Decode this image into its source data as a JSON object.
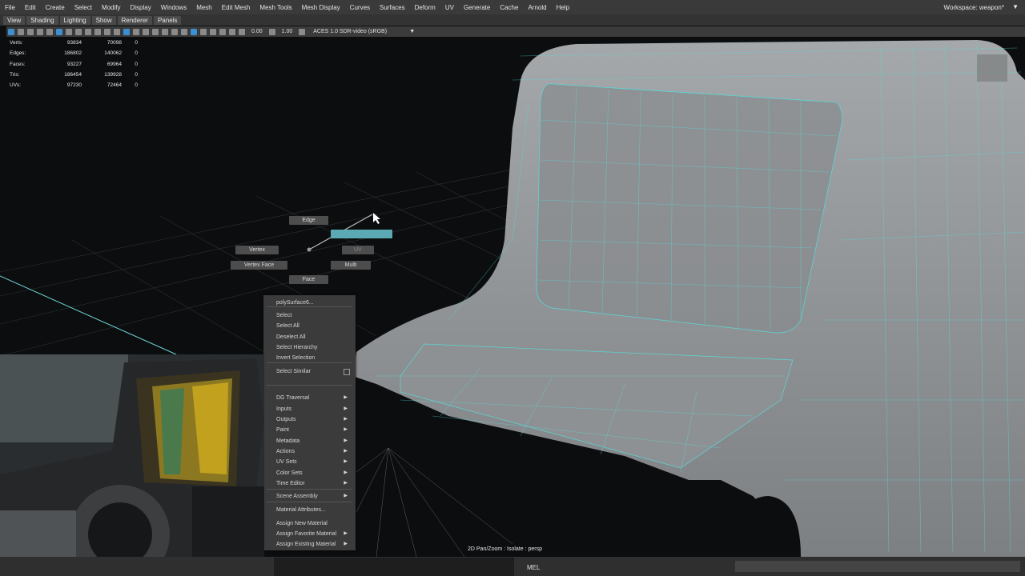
{
  "menubar": {
    "items": [
      "File",
      "Edit",
      "Create",
      "Select",
      "Modify",
      "Display",
      "Windows",
      "Mesh",
      "Edit Mesh",
      "Mesh Tools",
      "Mesh Display",
      "Curves",
      "Surfaces",
      "Deform",
      "UV",
      "Generate",
      "Cache",
      "Arnold",
      "Help"
    ],
    "workspace_label": "Workspace:",
    "workspace_value": "weapon*"
  },
  "panel_menu": [
    "View",
    "Shading",
    "Lighting",
    "Show",
    "Renderer",
    "Panels"
  ],
  "panel_toolbar": {
    "exposure": "0.00",
    "gamma": "1.00",
    "colorspace": "ACES 1.0 SDR-video (sRGB)"
  },
  "hud": {
    "rows": [
      {
        "label": "Verts:",
        "a": "93834",
        "b": "70098",
        "c": "0"
      },
      {
        "label": "Edges:",
        "a": "186802",
        "b": "140062",
        "c": "0"
      },
      {
        "label": "Faces:",
        "a": "93227",
        "b": "69964",
        "c": "0"
      },
      {
        "label": "Tris:",
        "a": "186454",
        "b": "139928",
        "c": "0"
      },
      {
        "label": "UVs:",
        "a": "97230",
        "b": "72464",
        "c": "0"
      }
    ]
  },
  "marking_menu": {
    "edge": "Edge",
    "vertex": "Vertex",
    "vertex_face": "Vertex Face",
    "face": "Face",
    "multi": "Multi",
    "uv": "UV"
  },
  "context_menu": {
    "items": [
      {
        "label": "polySurface6...",
        "arrow": false
      },
      {
        "label": "Select",
        "arrow": false
      },
      {
        "label": "Select All",
        "arrow": false
      },
      {
        "label": "Deselect All",
        "arrow": false
      },
      {
        "label": "Select Hierarchy",
        "arrow": false
      },
      {
        "label": "Invert Selection",
        "arrow": false
      },
      {
        "label": "Select Similar",
        "arrow": false,
        "option": true
      },
      {
        "label": "DG Traversal",
        "arrow": true
      },
      {
        "label": "Inputs",
        "arrow": true
      },
      {
        "label": "Outputs",
        "arrow": true
      },
      {
        "label": "Paint",
        "arrow": true
      },
      {
        "label": "Metadata",
        "arrow": true
      },
      {
        "label": "Actions",
        "arrow": true
      },
      {
        "label": "UV Sets",
        "arrow": true
      },
      {
        "label": "Color Sets",
        "arrow": true
      },
      {
        "label": "Time Editor",
        "arrow": true
      },
      {
        "label": "Scene Assembly",
        "arrow": true
      },
      {
        "label": "Material Attributes...",
        "arrow": false
      },
      {
        "label": "Assign New Material",
        "arrow": false
      },
      {
        "label": "Assign Favorite Material",
        "arrow": true
      },
      {
        "label": "Assign Existing Material",
        "arrow": true
      }
    ]
  },
  "viewport": {
    "panel_label": "2D Pan/Zoom : Isolate : persp"
  },
  "command_line": {
    "label": "MEL"
  },
  "colors": {
    "menubar_bg": "#3a3a3a",
    "wire": "#5ad6d6",
    "mesh": "#8c8f91",
    "accent": "#3d8fd0"
  }
}
